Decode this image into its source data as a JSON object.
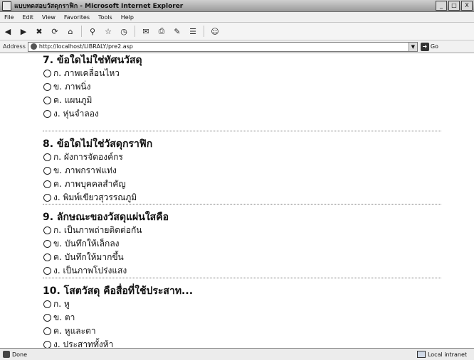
{
  "window": {
    "title": "แบบทดสอบวัสดุกราฟิก - Microsoft Internet Explorer",
    "controls": [
      "_",
      "□",
      "X"
    ]
  },
  "menu": [
    "File",
    "Edit",
    "View",
    "Favorites",
    "Tools",
    "Help"
  ],
  "toolbar": {
    "buttons": [
      "back-icon",
      "forward-icon",
      "stop-icon",
      "refresh-icon",
      "home-icon",
      "search-icon",
      "favorites-icon",
      "history-icon",
      "mail-icon",
      "print-icon",
      "edit-icon",
      "discuss-icon",
      "messenger-icon"
    ]
  },
  "address": {
    "label": "Address",
    "url": "http://localhost/LIBRALY/pre2.asp",
    "go_label": "Go"
  },
  "questions": [
    {
      "title": "7. ข้อใดไม่ใช่ทัศนวัสดุ",
      "options": [
        "ก. ภาพเคลื่อนไหว",
        "ข. ภาพนิ่ง",
        "ค. แผนภูมิ",
        "ง. หุ่นจำลอง"
      ]
    },
    {
      "title": "8. ข้อใดไม่ใช่วัสดุกราฟิก",
      "options": [
        "ก. ผังการจัดองค์กร",
        "ข. ภาพกราฟแท่ง",
        "ค. ภาพบุคคลสำคัญ",
        "ง. พิมพ์เขียวสุวรรณภูมิ"
      ]
    },
    {
      "title": "9. ลักษณะของวัสดุแผ่นใสคือ",
      "options": [
        "ก. เป็นภาพถ่ายติดต่อกัน",
        "ข. บันทึกให้เล็กลง",
        "ค. บันทึกให้มากขึ้น",
        "ง. เป็นภาพโปร่งแสง"
      ]
    },
    {
      "title": "10. โสตวัสดุ คือสื่อที่ใช้ประสาท...",
      "options": [
        "ก. หู",
        "ข. ตา",
        "ค. หูและตา",
        "ง. ประสาททั้งห้า"
      ]
    }
  ],
  "status": {
    "left": "Done",
    "zone": "Local intranet"
  }
}
